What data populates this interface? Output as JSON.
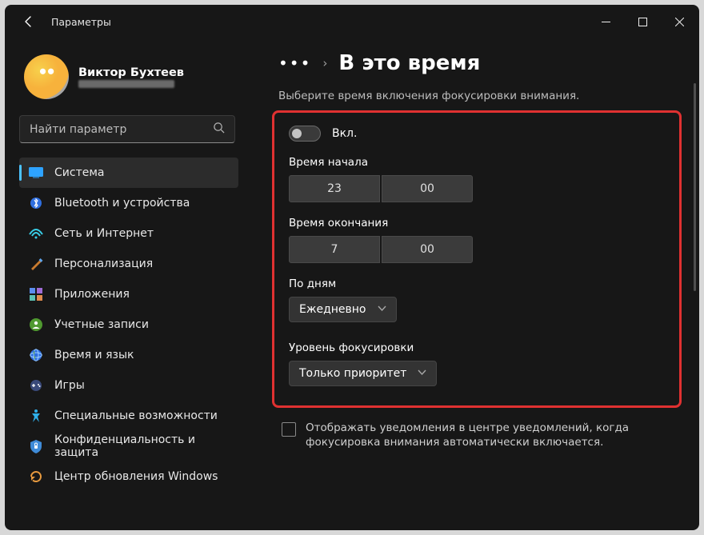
{
  "titlebar": {
    "title": "Параметры"
  },
  "profile": {
    "name": "Виктор Бухтеев"
  },
  "search": {
    "placeholder": "Найти параметр"
  },
  "nav": {
    "items": [
      {
        "id": "system",
        "label": "Система"
      },
      {
        "id": "bluetooth",
        "label": "Bluetooth и устройства"
      },
      {
        "id": "network",
        "label": "Сеть и Интернет"
      },
      {
        "id": "personalize",
        "label": "Персонализация"
      },
      {
        "id": "apps",
        "label": "Приложения"
      },
      {
        "id": "accounts",
        "label": "Учетные записи"
      },
      {
        "id": "timelang",
        "label": "Время и язык"
      },
      {
        "id": "gaming",
        "label": "Игры"
      },
      {
        "id": "a11y",
        "label": "Специальные возможности"
      },
      {
        "id": "privacy",
        "label": "Конфиденциальность и защита"
      },
      {
        "id": "update",
        "label": "Центр обновления Windows"
      }
    ],
    "selected": 0
  },
  "breadcrumb": {
    "page": "В это время"
  },
  "subtitle": "Выберите время включения фокусировки внимания.",
  "toggle": {
    "state": "off",
    "label": "Вкл."
  },
  "sections": {
    "start": {
      "label": "Время начала",
      "hour": "23",
      "minute": "00"
    },
    "end": {
      "label": "Время окончания",
      "hour": "7",
      "minute": "00"
    },
    "days": {
      "label": "По дням",
      "value": "Ежедневно"
    },
    "level": {
      "label": "Уровень фокусировки",
      "value": "Только приоритет"
    }
  },
  "checkbox": {
    "label": "Отображать уведомления в центре уведомлений, когда фокусировка внимания автоматически включается."
  }
}
